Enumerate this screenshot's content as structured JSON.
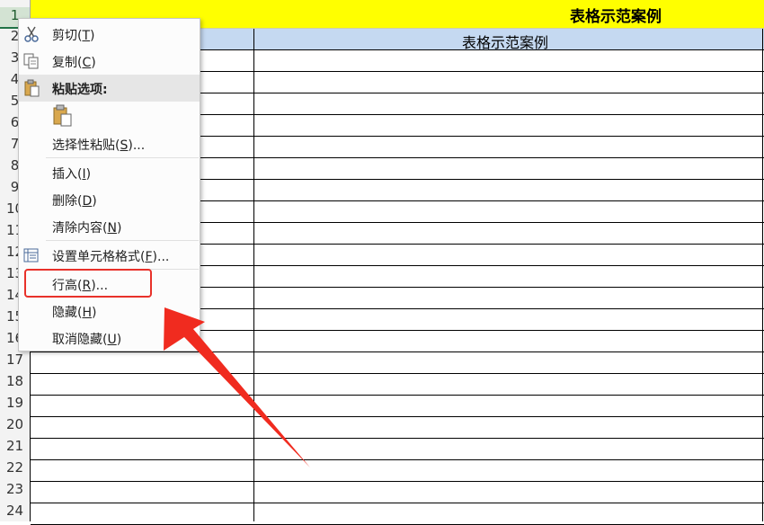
{
  "sheet": {
    "title": "表格示范案例",
    "header": "表格示范案例",
    "row_numbers": [
      "1",
      "2",
      "3",
      "4",
      "5",
      "6",
      "7",
      "8",
      "9",
      "10",
      "11",
      "12",
      "13",
      "14",
      "15",
      "16",
      "17",
      "18",
      "19",
      "20",
      "21",
      "22",
      "23",
      "24"
    ]
  },
  "context_menu": {
    "cut": {
      "text": "剪切",
      "key": "T"
    },
    "copy": {
      "text": "复制",
      "key": "C"
    },
    "paste_options": "粘贴选项:",
    "paste_special": {
      "text": "选择性粘贴",
      "key": "S",
      "suffix": "..."
    },
    "insert": {
      "text": "插入",
      "key": "I"
    },
    "delete": {
      "text": "删除",
      "key": "D"
    },
    "clear": {
      "text": "清除内容",
      "key": "N"
    },
    "format_cells": {
      "text": "设置单元格格式",
      "key": "F",
      "suffix": "..."
    },
    "row_height": {
      "text": "行高",
      "key": "R",
      "suffix": "..."
    },
    "hide": {
      "text": "隐藏",
      "key": "H"
    },
    "unhide": {
      "text": "取消隐藏",
      "key": "U"
    }
  },
  "icons": [
    "scissors-icon",
    "copy-icon",
    "paste-icon",
    "clipboard-icon",
    "format-cells-icon"
  ],
  "colors": {
    "title_bg": "#ffff00",
    "header_bg": "#c5d9f1",
    "highlight": "#e8312a"
  }
}
